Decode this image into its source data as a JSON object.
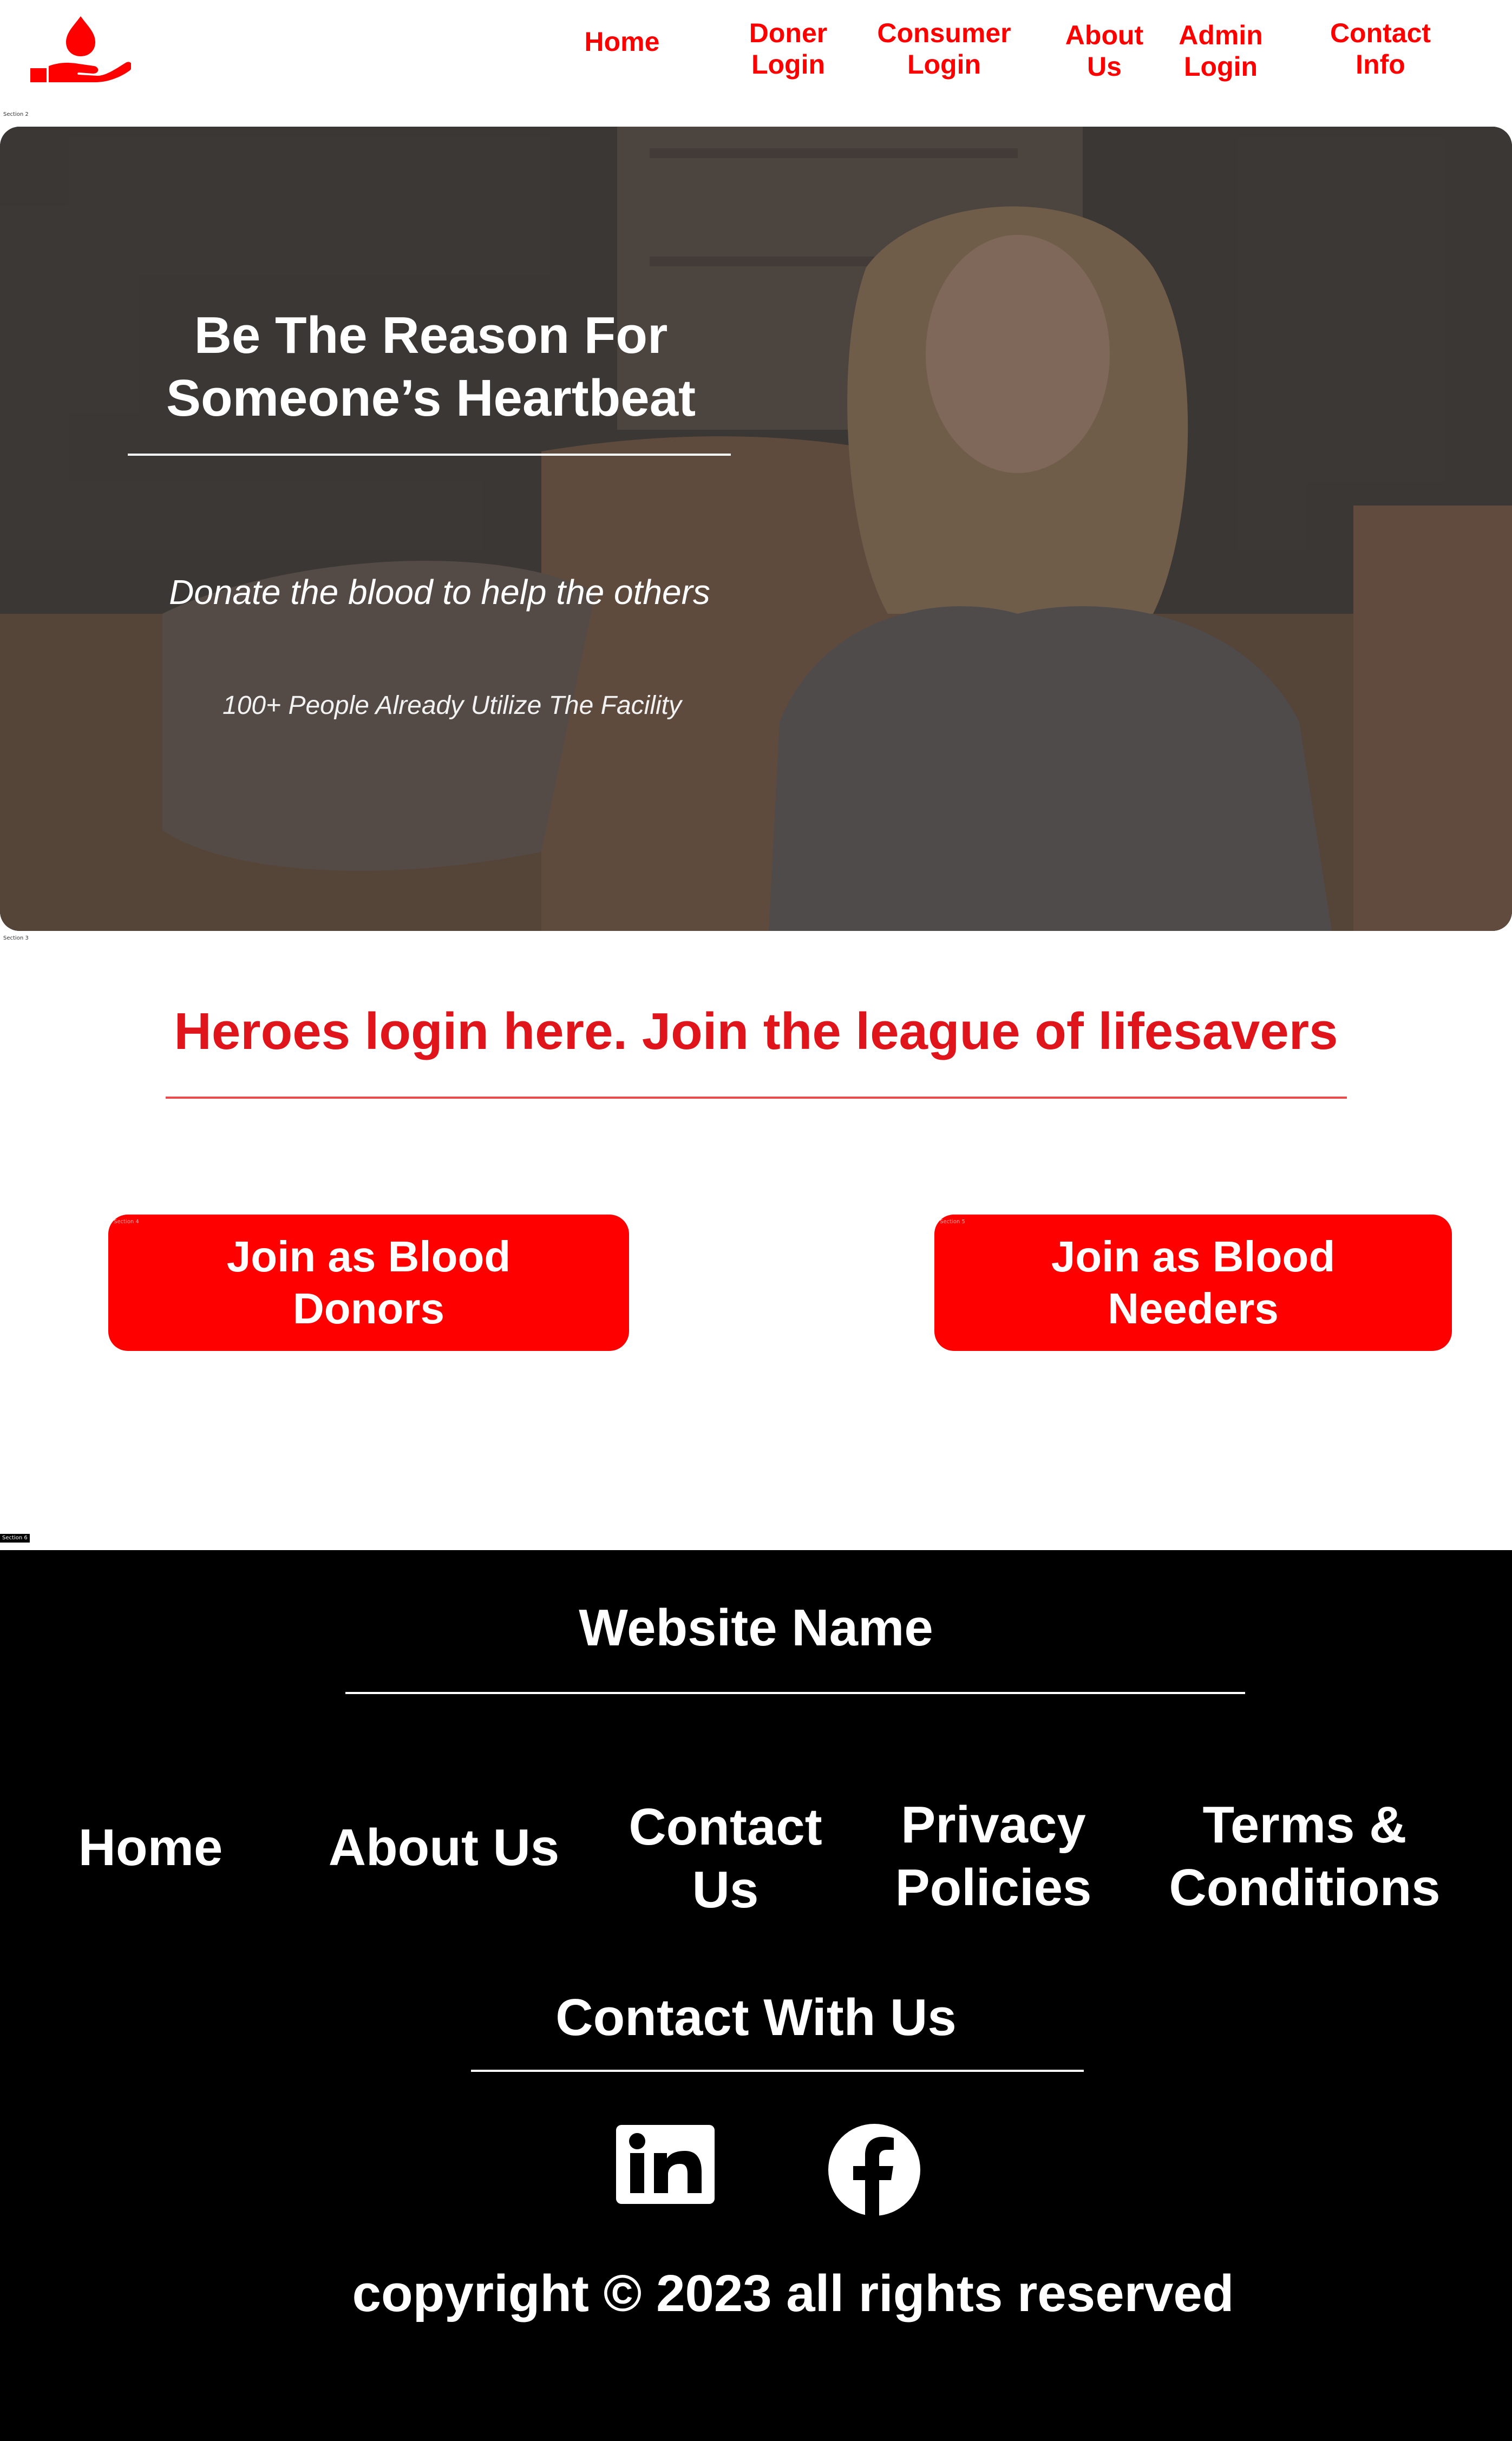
{
  "nav": {
    "items": [
      {
        "label": "Home"
      },
      {
        "label": "Doner\nLogin"
      },
      {
        "label": "Consumer\nLogin"
      },
      {
        "label": "About\nUs"
      },
      {
        "label": "Admin\nLogin"
      },
      {
        "label": "Contact\nInfo"
      }
    ]
  },
  "section_tags": {
    "s2": "Section 2",
    "s3": "Section 3",
    "s4": "Section 4",
    "s5": "Section 5",
    "s6": "Section 6"
  },
  "hero": {
    "title": "Be The Reason For\nSomeone’s Heartbeat",
    "subtitle": "Donate the blood to help the others",
    "stat": "100+ People Already Utilize The Facility"
  },
  "heroes": {
    "heading": "Heroes login here. Join the league of lifesavers",
    "donor_button": "Join as Blood\nDonors",
    "needer_button": "Join as Blood\nNeeders"
  },
  "footer": {
    "site_name": "Website Name",
    "links": [
      {
        "label": "Home"
      },
      {
        "label": "About Us"
      },
      {
        "label": "Contact\nUs"
      },
      {
        "label": "Privacy\nPolicies"
      },
      {
        "label": "Terms &\nConditions"
      }
    ],
    "contact_heading": "Contact With Us",
    "social": [
      {
        "icon": "linkedin-icon"
      },
      {
        "icon": "facebook-icon"
      }
    ],
    "copyright": "copyright © 2023 all rights reserved"
  },
  "colors": {
    "accent": "#ff0000",
    "heading_red": "#e0141b",
    "footer_bg": "#000000"
  }
}
